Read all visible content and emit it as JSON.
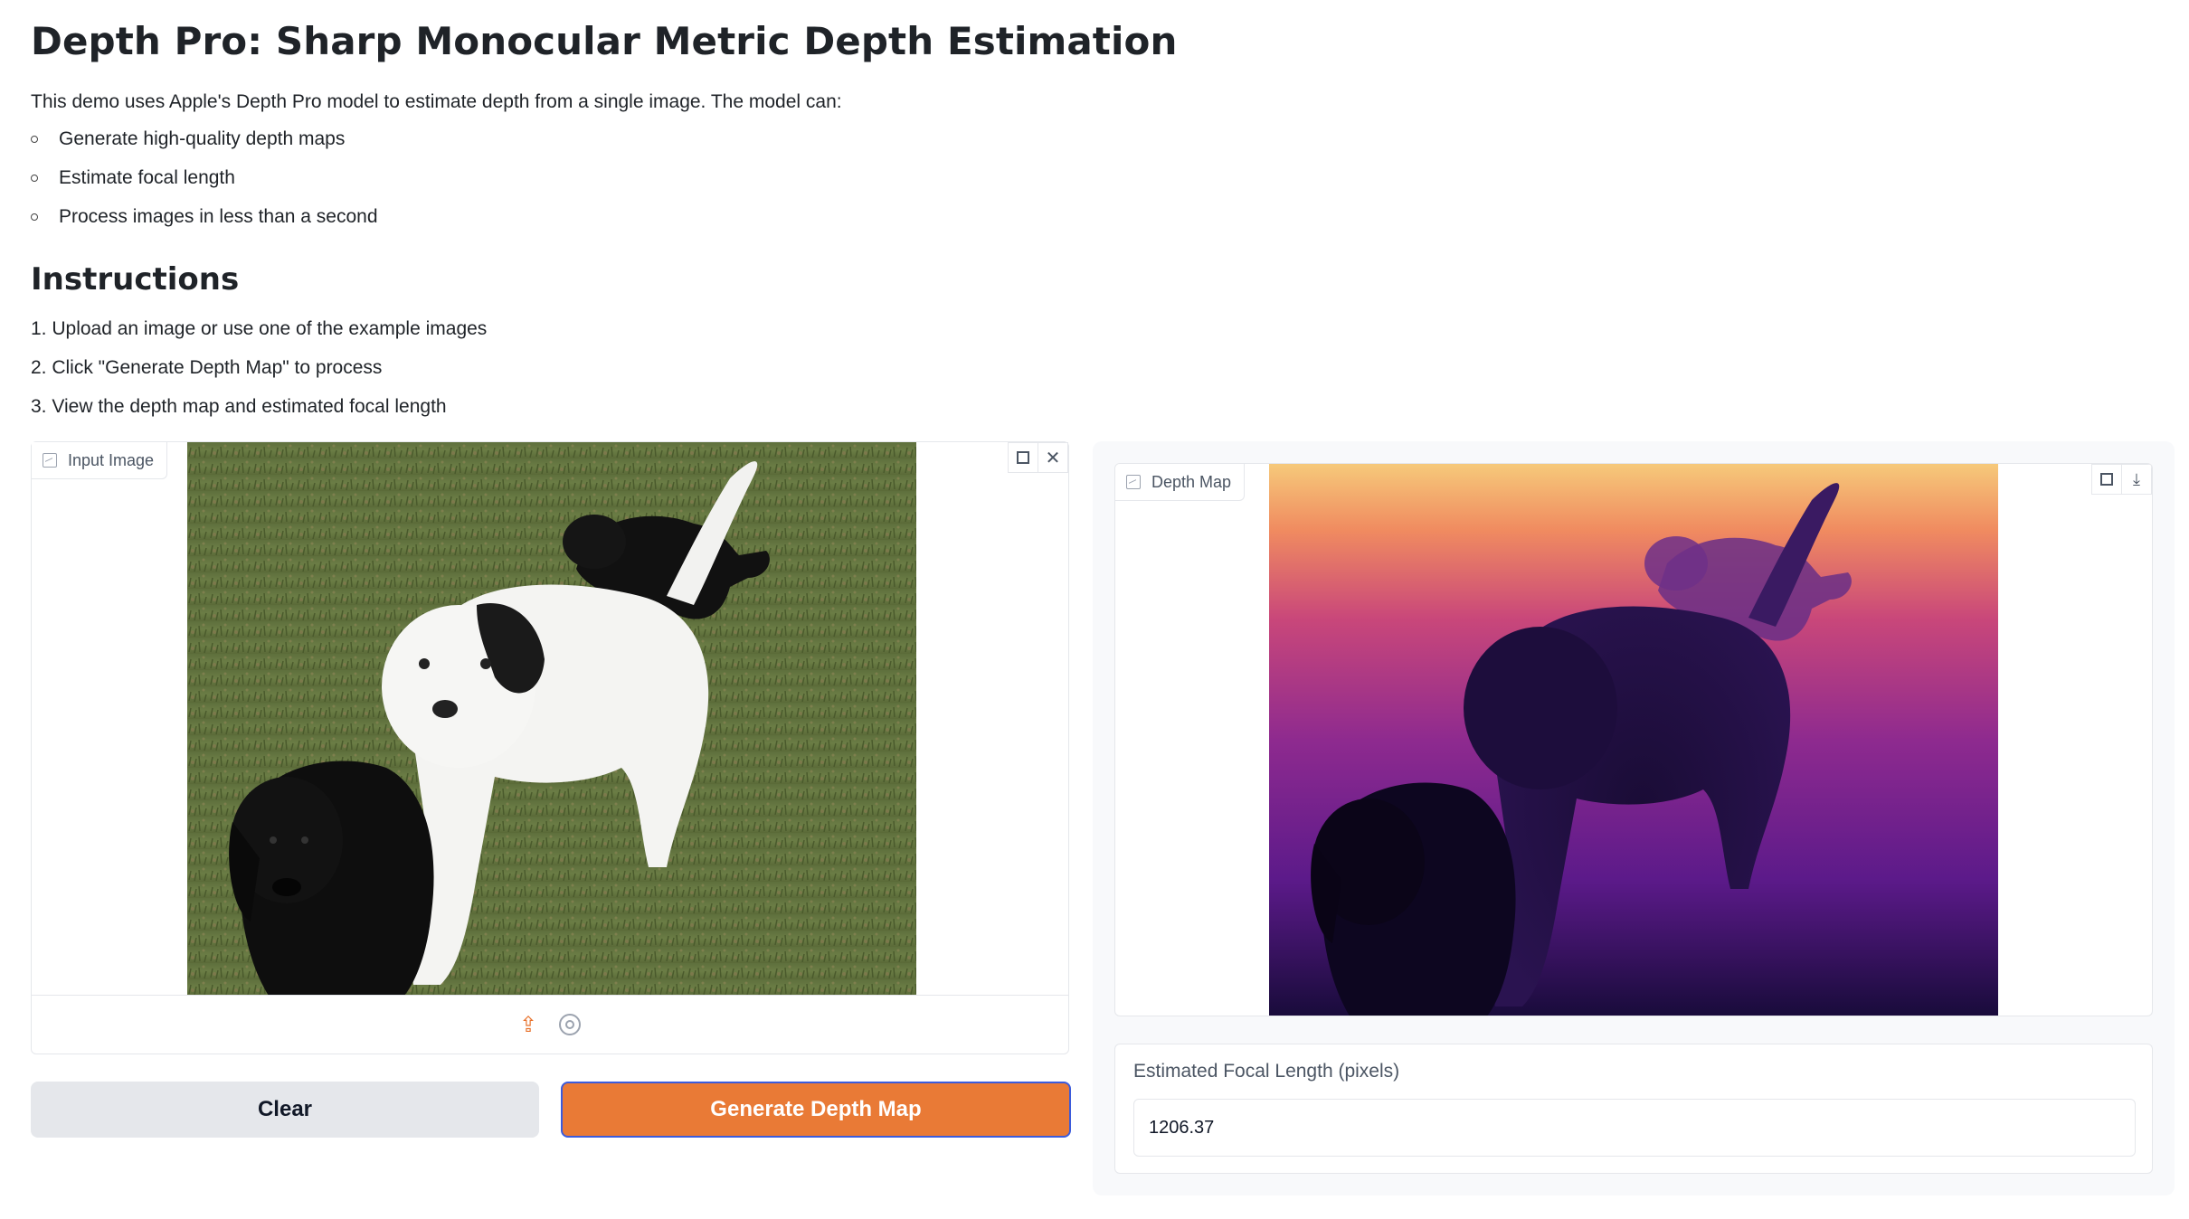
{
  "page": {
    "title": "Depth Pro: Sharp Monocular Metric Depth Estimation",
    "intro": "This demo uses Apple's Depth Pro model to estimate depth from a single image. The model can:",
    "features": [
      "Generate high-quality depth maps",
      "Estimate focal length",
      "Process images in less than a second"
    ],
    "instructions_heading": "Instructions",
    "steps": [
      "1. Upload an image or use one of the example images",
      "2. Click \"Generate Depth Map\" to process",
      "3. View the depth map and estimated focal length"
    ]
  },
  "input_panel": {
    "label": "Input Image",
    "icons": [
      "image-icon",
      "fullscreen-icon",
      "close-icon",
      "upload-icon",
      "webcam-icon"
    ]
  },
  "buttons": {
    "clear": "Clear",
    "generate": "Generate Depth Map"
  },
  "output_panel": {
    "label": "Depth Map",
    "icons": [
      "image-icon",
      "fullscreen-icon",
      "download-icon"
    ]
  },
  "focal": {
    "label": "Estimated Focal Length (pixels)",
    "value": "1206.37"
  },
  "colors": {
    "accent": "#e97a36",
    "focus_border": "#3b5bdb",
    "clear_bg": "#e5e7eb"
  }
}
